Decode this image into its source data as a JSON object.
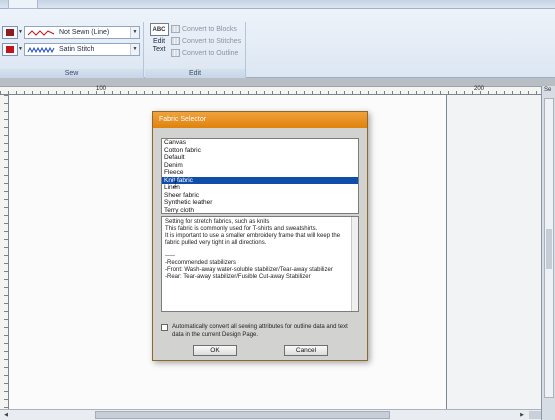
{
  "ribbon": {
    "sew": {
      "label": "Sew",
      "line_combo": "Not Sewn (Line)",
      "region_combo": "Satin Stitch",
      "line_color": "#8b1e1e",
      "region_color": "#c0141b"
    },
    "edit": {
      "label": "Edit",
      "edit_text_icon": "ABC",
      "edit_text_label": "Edit\nText",
      "convert_to_blocks": "Convert to Blocks",
      "convert_to_stitches": "Convert to Stitches",
      "convert_to_outline": "Convert to Outline"
    }
  },
  "ruler": {
    "n100": "100",
    "n200": "200"
  },
  "side_panel": {
    "title": "Se"
  },
  "dialog": {
    "title": "Fabric Selector",
    "fabrics": [
      "Canvas",
      "Cotton fabric",
      "Default",
      "Denim",
      "Fleece",
      "Knit fabric",
      "Linen",
      "Sheer fabric",
      "Synthetic leather",
      "Terry cloth"
    ],
    "selected_index": 5,
    "description": {
      "line1": "Setting for stretch fabrics, such as knits",
      "line2": "This fabric is commonly used for T-shirts and sweatshirts.",
      "line3": "It is important to use a smaller embroidery frame that will keep the",
      "line4": "fabric pulled very tight in all directions.",
      "line5": "-----",
      "line6": "-Recommended stabilizers",
      "line7": "-Front: Wash-away water-soluble stabilizer/Tear-away stabilizer",
      "line8": "-Rear: Tear-away stabilizer/Fusible Cut-away Stabilizer"
    },
    "auto_convert_label": "Automatically convert all sewing attributes for outline data and text data in the current Design Page.",
    "ok_label": "OK",
    "cancel_label": "Cancel"
  }
}
